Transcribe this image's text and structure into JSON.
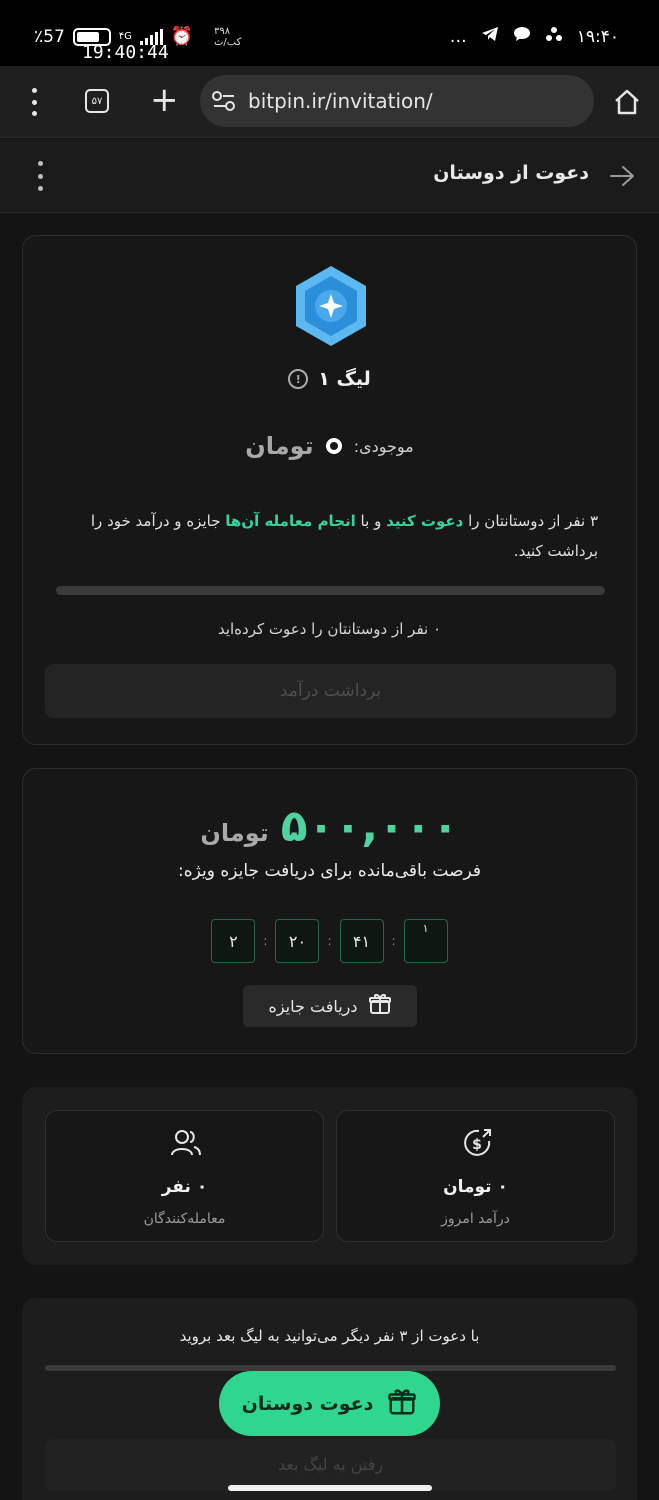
{
  "status_bar": {
    "battery": "57",
    "battery_symbol": "٪",
    "overlay_time": "19:40:44",
    "network_small": "۴G",
    "data_speed": "۳۹۸\nکب/ث",
    "time": "۱۹:۴۰",
    "more": "…"
  },
  "browser": {
    "tab_count": "۵۷",
    "url": "bitpin.ir/invitation/"
  },
  "header": {
    "title": "دعوت از دوستان"
  },
  "league": {
    "name": "لیگ ۱",
    "balance_label": "موجودی:",
    "balance_unit": "تومان",
    "desc_part1": "۳ نفر از دوستانتان را ",
    "desc_hl1": "دعوت کنید",
    "desc_part2": " و با ",
    "desc_hl2": "انجام معامله آن‌ها",
    "desc_part3": " جایزه و درآمد خود را برداشت کنید.",
    "progress": 0,
    "invited_text": "۰ نفر از دوستانتان را دعوت کرده‌اید",
    "withdraw_label": "برداشت درآمد"
  },
  "prize": {
    "amount": "۵۰۰,۰۰۰",
    "unit": "تومان",
    "subtitle": "فرصت باقی‌مانده برای دریافت جایزه ویژه:",
    "countdown": [
      "۲",
      "۲۰",
      "۴۱",
      "۱"
    ],
    "claim_label": "دریافت جایزه"
  },
  "stats": {
    "traders_value": "۰ نفر",
    "traders_label": "معامله‌کنندگان",
    "income_value": "۰ تومان",
    "income_label": "درآمد امروز"
  },
  "next_league": {
    "text": "با دعوت از ۳ نفر دیگر می‌توانید به لیگ بعد بروید",
    "progress": 0,
    "button_label": "رفتن به لیگ بعد"
  },
  "invite": {
    "label": "دعوت دوستان"
  },
  "colors": {
    "accent": "#2fd68d",
    "highlight": "#37d39a",
    "background": "#141414"
  }
}
